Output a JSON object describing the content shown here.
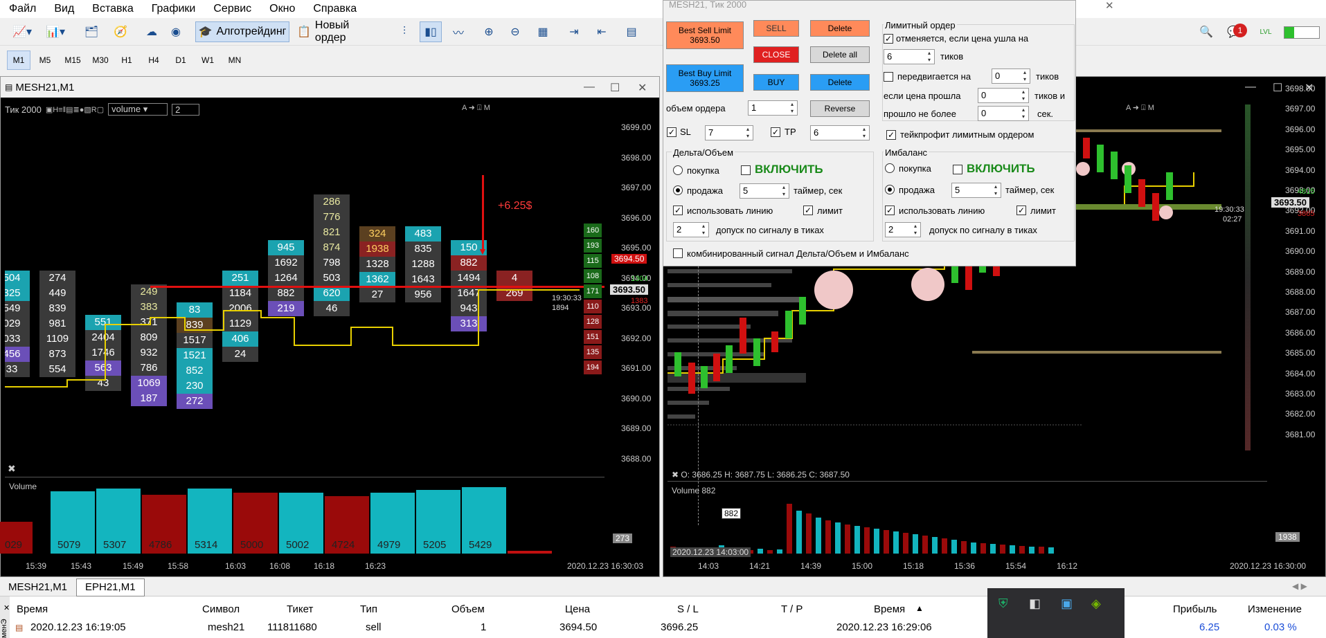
{
  "menu": [
    "Файл",
    "Вид",
    "Вставка",
    "Графики",
    "Сервис",
    "Окно",
    "Справка"
  ],
  "toolbar": {
    "algo": "Алготрейдинг",
    "new_order": "Новый ордер",
    "notif_count": "1"
  },
  "timeframes": [
    "M1",
    "M5",
    "M15",
    "M30",
    "H1",
    "H4",
    "D1",
    "W1",
    "MN"
  ],
  "left_chart": {
    "title": "MESH21,M1",
    "tick_label": "Тик  2000",
    "indicator": "volume",
    "indicator_val": "2",
    "price_ticks": [
      "3699.00",
      "3698.00",
      "3697.00",
      "3696.00",
      "3695.00",
      "3694.00",
      "3693.00",
      "3692.00",
      "3691.00",
      "3690.00",
      "3689.00",
      "3688.00"
    ],
    "profit": "+6.25$",
    "line_price": "3694.50",
    "cur_price": "3693.50",
    "bid_small": "1304",
    "ask_small": "1383",
    "time_left": "19:30:33",
    "ticks_left": "1894",
    "ladder": [
      "160",
      "193",
      "115",
      "108",
      "171",
      "110",
      "128",
      "151",
      "135",
      "194"
    ],
    "volume_label": "Volume",
    "volume_values": [
      "029",
      "5079",
      "5307",
      "4786",
      "5314",
      "5000",
      "5002",
      "4724",
      "4979",
      "5205",
      "5429"
    ],
    "vol_scale": "273",
    "time_ticks": [
      "15:39",
      "15:43",
      "15:49",
      "15:58",
      "16:03",
      "16:08",
      "16:18",
      "16:23"
    ],
    "time_end": "2020.12.23 16:30:03",
    "columns": [
      [
        "504",
        "325",
        "549",
        "029",
        "033",
        "456",
        "33"
      ],
      [
        "274",
        "449",
        "839",
        "981",
        "1109",
        "873",
        "554"
      ],
      [
        "551",
        "2404",
        "1746",
        "563",
        "43"
      ],
      [
        "249",
        "383",
        "371",
        "809",
        "932",
        "786",
        "1069",
        "187"
      ],
      [
        "83",
        "839",
        "1517",
        "1521",
        "852",
        "230",
        "272"
      ],
      [
        "251",
        "1184",
        "2006",
        "1129",
        "406",
        "24"
      ],
      [
        "945",
        "1692",
        "1264",
        "882",
        "219"
      ],
      [
        "286",
        "776",
        "821",
        "874",
        "798",
        "503",
        "620",
        "46"
      ],
      [
        "324",
        "1938",
        "1328",
        "1362",
        "27"
      ],
      [
        "483",
        "835",
        "1288",
        "1643",
        "956"
      ],
      [
        "150",
        "882",
        "1494",
        "1647",
        "943",
        "313"
      ],
      [
        "4",
        "269"
      ]
    ]
  },
  "right_chart": {
    "price_ticks": [
      "3698.00",
      "3697.00",
      "3696.00",
      "3695.00",
      "3694.00",
      "3693.00",
      "3692.00",
      "3691.00",
      "3690.00",
      "3689.00",
      "3688.00",
      "3687.00",
      "3686.00",
      "3685.00",
      "3684.00",
      "3683.00",
      "3682.00",
      "3681.00"
    ],
    "bid_val": "4815",
    "cur_price": "3693.50",
    "ask_val": "3865",
    "time_left": "19:30:33",
    "time_small": "02:27",
    "ohlc": "O: 3686.25  H: 3687.75  L: 3686.25  C: 3687.50",
    "volume_label": "Volume 882",
    "vol_marker": "882",
    "vol_scale": "1938",
    "cursor_time": "2020.12.23 14:03:00",
    "time_ticks": [
      "14:03",
      "14:21",
      "14:39",
      "15:00",
      "15:18",
      "15:36",
      "15:54",
      "16:12"
    ],
    "time_end": "2020.12.23 16:30:00"
  },
  "dialog": {
    "title": "MESH21, Тик  2000",
    "best_sell": "Best Sell Limit",
    "best_sell_price": "3693.50",
    "best_buy": "Best Buy Limit",
    "best_buy_price": "3693.25",
    "sell": "SELL",
    "close": "CLOSE",
    "buy": "BUY",
    "delete": "Delete",
    "delete_all": "Delete all",
    "reverse": "Reverse",
    "volume_label": "объем ордера",
    "volume_val": "1",
    "sl": "SL",
    "sl_val": "7",
    "tp": "TP",
    "tp_val": "6",
    "limit_title": "Лимитный ордер",
    "cancel_label": "отменяется, если цена ушла на",
    "cancel_val": "6",
    "ticks": "тиков",
    "move_label": "передвигается на",
    "move_val": "0",
    "if_passed": "если цена прошла",
    "passed_val": "0",
    "ticks_and": "тиков и",
    "not_more": "прошло не более",
    "sec_val": "0",
    "sec": "сек.",
    "tp_limit": "тейкпрофит лимитным ордером",
    "delta_title": "Дельта/Объем",
    "imb_title": "Имбаланс",
    "buy_lbl": "покупка",
    "sell_lbl": "продажа",
    "enable": "ВКЛЮЧИТЬ",
    "timer_val": "5",
    "timer": "таймер, сек",
    "use_line": "использовать линию",
    "limit": "лимит",
    "tol_val": "2",
    "tolerance": "допуск по сигналу в тиках",
    "combined": "комбинированный сигнал Дельта/Объем и Имбаланс"
  },
  "tabs": [
    "MESH21,M1",
    "EPH21,M1"
  ],
  "table": {
    "headers": [
      "Время",
      "Символ",
      "Тикет",
      "Тип",
      "Объем",
      "Цена",
      "S / L",
      "T / P",
      "Время",
      "Прибыль",
      "Изменение"
    ],
    "row": [
      "2020.12.23 16:19:05",
      "mesh21",
      "111811680",
      "sell",
      "1",
      "3694.50",
      "3696.25",
      "",
      "2020.12.23 16:29:06",
      "6.25",
      "0.03 %"
    ]
  },
  "side_tab": "менЭ"
}
